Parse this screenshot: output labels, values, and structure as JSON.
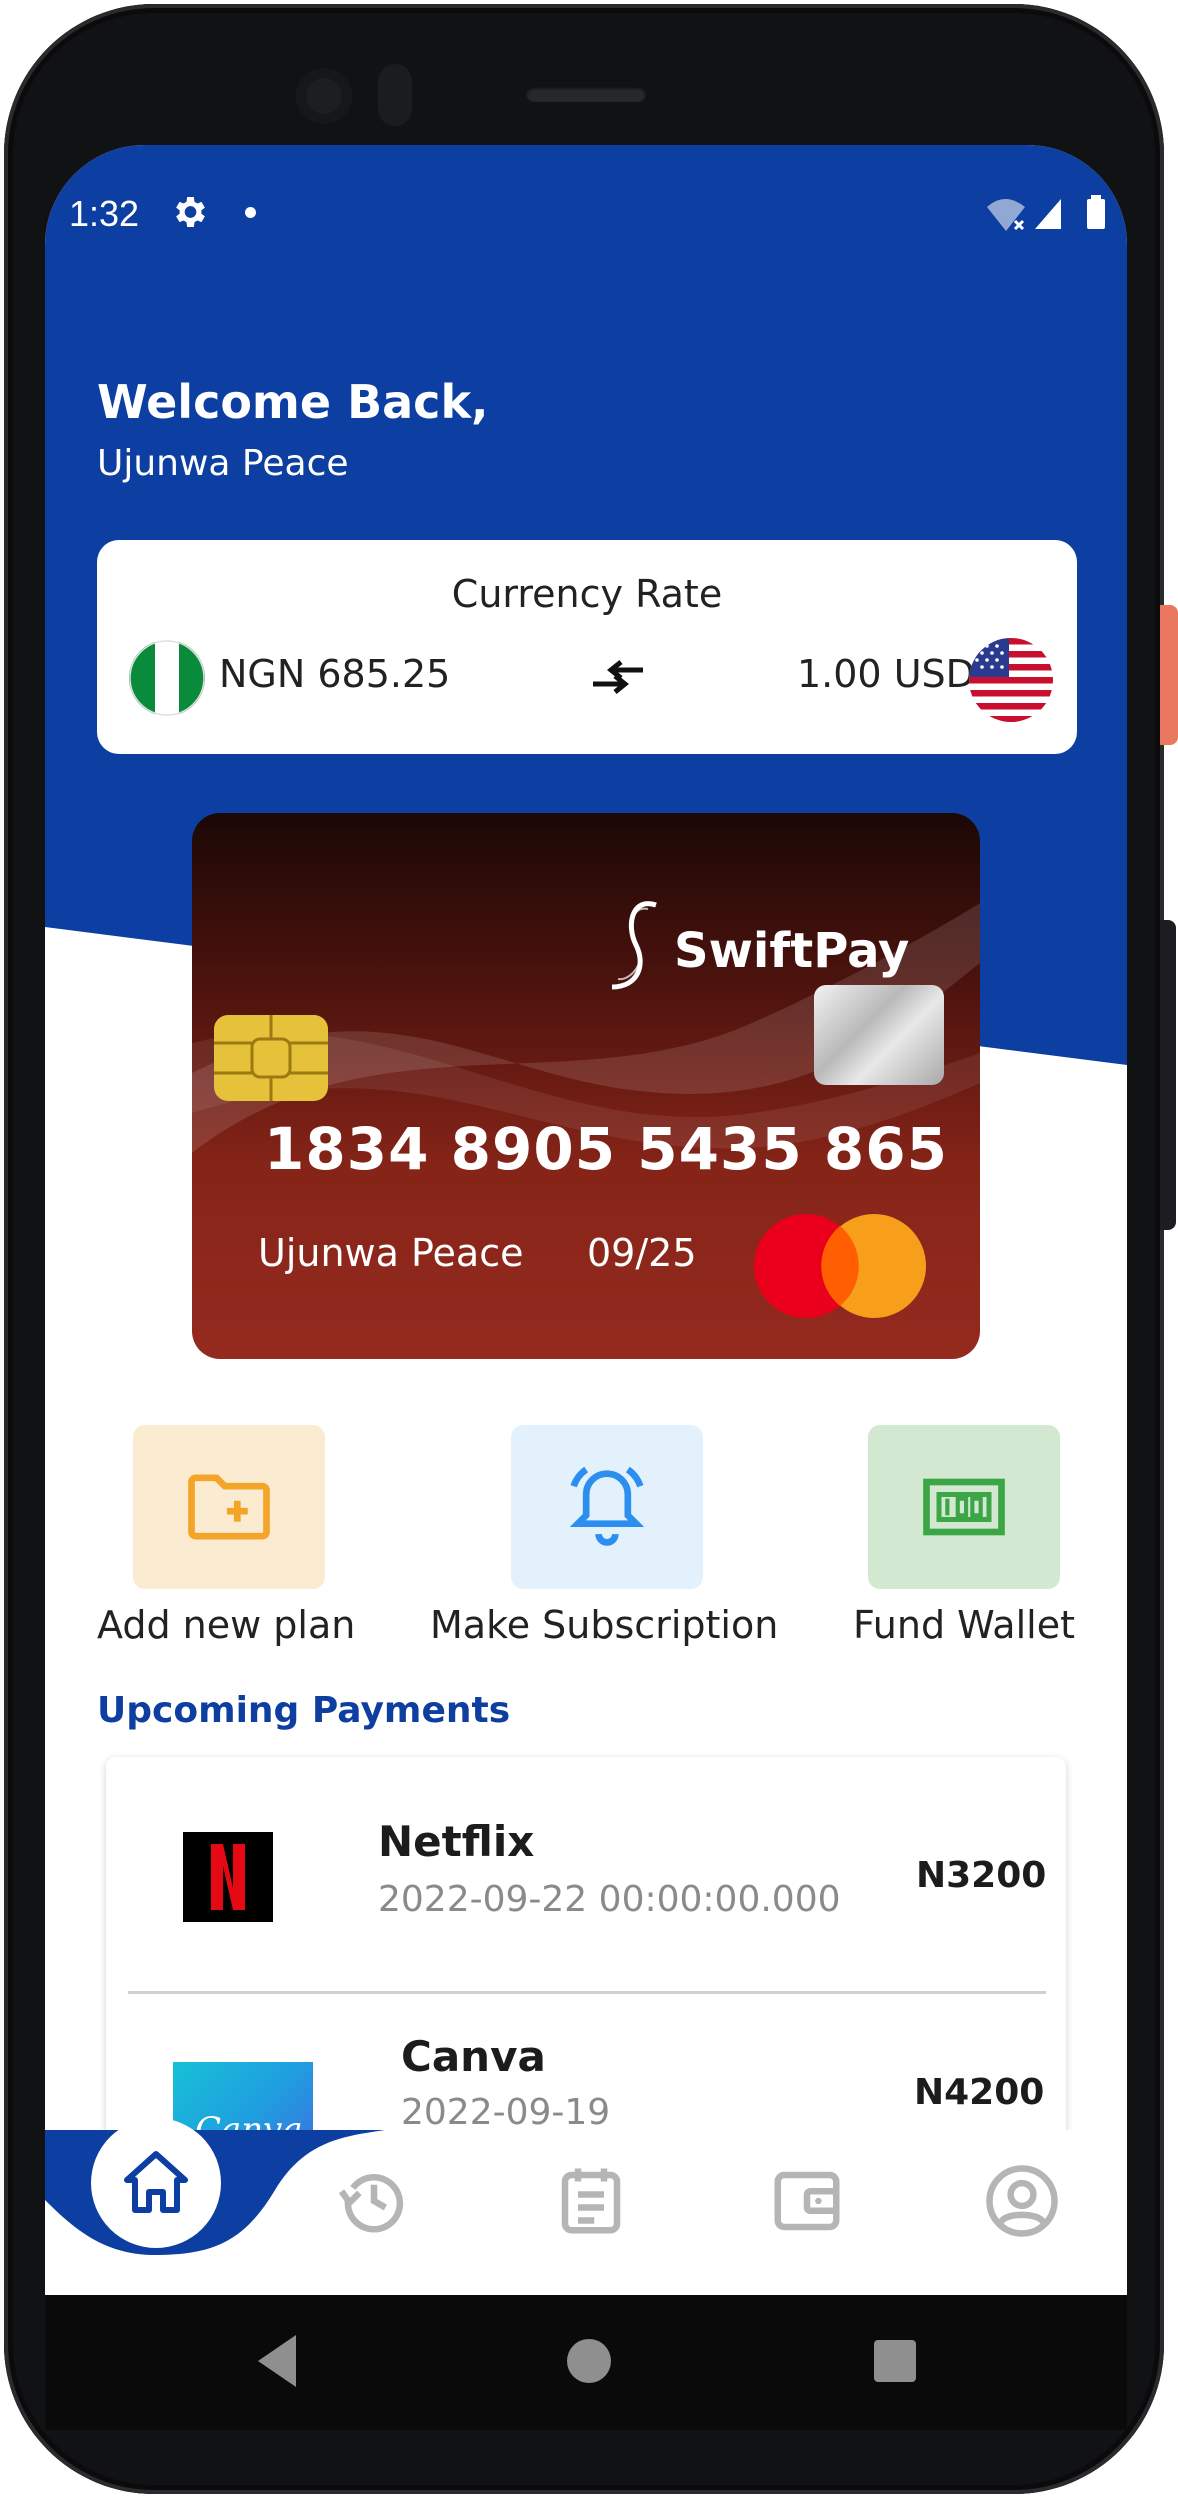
{
  "status_bar": {
    "time": "1:32"
  },
  "header": {
    "greeting": "Welcome Back,",
    "user_name": "Ujunwa Peace"
  },
  "currency_rate": {
    "title": "Currency Rate",
    "from": "NGN 685.25",
    "to": "1.00 USD"
  },
  "card": {
    "brand": "SwiftPay",
    "number": "1834 8905 5435 865",
    "holder": "Ujunwa Peace",
    "expiry": "09/25",
    "network_icon": "mastercard-icon"
  },
  "quick_actions": [
    {
      "label": "Add new plan",
      "icon": "folder-plus-icon",
      "color": "#f4a428"
    },
    {
      "label": "Make Subscription",
      "icon": "bell-icon",
      "color": "#2c8ff0"
    },
    {
      "label": "Fund Wallet",
      "icon": "money-icon",
      "color": "#3ca646"
    }
  ],
  "upcoming": {
    "title": "Upcoming Payments",
    "items": [
      {
        "name": "Netflix",
        "date": "2022-09-22 00:00:00.000",
        "amount": "N3200"
      },
      {
        "name": "Canva",
        "date": "2022-09-19",
        "amount": "N4200",
        "logo_text": "Canva"
      }
    ]
  },
  "bottom_nav": {
    "active": "home",
    "items": [
      "home-icon",
      "history-icon",
      "calendar-icon",
      "wallet-icon",
      "profile-icon"
    ]
  },
  "colors": {
    "primary": "#0d3ea1",
    "card_red": "#952a1f",
    "background": "#ffffff"
  }
}
